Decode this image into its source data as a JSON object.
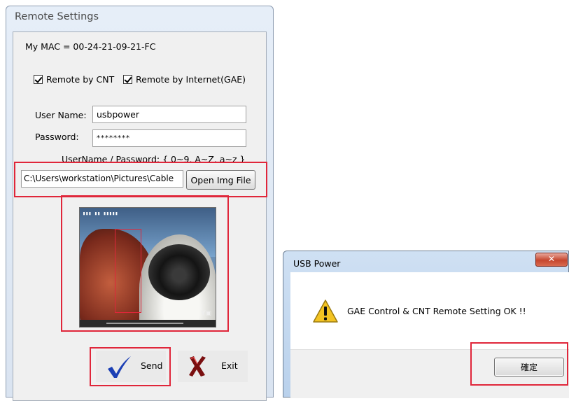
{
  "remote_settings": {
    "title": "Remote Settings",
    "mac_label": "My MAC = 00-24-21-09-21-FC",
    "remote_cnt_label": "Remote by CNT",
    "remote_cnt_checked": true,
    "remote_gae_label": "Remote by Internet(GAE)",
    "remote_gae_checked": true,
    "username_label": "User Name:",
    "username_value": "usbpower",
    "password_label": "Password:",
    "password_value": "********",
    "hint_label": "UserName / Password: { 0~9, A~Z, a~z }",
    "image_path": "C:\\Users\\workstation\\Pictures\\Cable",
    "open_img_label": "Open Img File",
    "send_label": "Send",
    "exit_label": "Exit"
  },
  "usb_power_dialog": {
    "title": "USB Power",
    "message": "GAE Control & CNT Remote Setting OK !!",
    "ok_label": "確定"
  },
  "icons": {
    "send": "checkmark-icon",
    "exit": "x-icon",
    "warning": "warning-icon",
    "close": "close-icon"
  },
  "colors": {
    "highlight": "#e0263a",
    "check_blue": "#1b3fb5",
    "warning_yellow": "#f3c322"
  }
}
